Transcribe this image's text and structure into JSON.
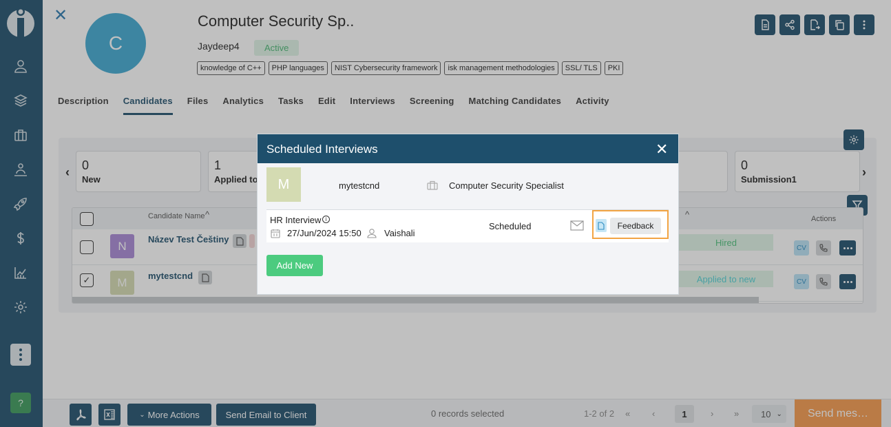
{
  "sidebar": {
    "items": [
      {
        "icon": "person-icon"
      },
      {
        "icon": "layers-icon"
      },
      {
        "icon": "briefcase-icon"
      },
      {
        "icon": "org-chart-icon"
      },
      {
        "icon": "rocket-icon"
      },
      {
        "icon": "dollar-icon"
      },
      {
        "icon": "bar-chart-icon"
      },
      {
        "icon": "gear-icon"
      }
    ],
    "help_label": "?"
  },
  "job": {
    "avatar_letter": "C",
    "title": "Computer Security Sp..",
    "owner": "Jaydeep4",
    "status": "Active",
    "tags": [
      "knowledge of C++",
      "PHP languages",
      "NIST Cybersecurity framework",
      "isk management methodologies",
      "SSL/ TLS",
      "PKI"
    ]
  },
  "tabs": [
    "Description",
    "Candidates",
    "Files",
    "Analytics",
    "Tasks",
    "Edit",
    "Interviews",
    "Screening",
    "Matching Candidates",
    "Activity"
  ],
  "active_tab": "Candidates",
  "stats": [
    {
      "count": "0",
      "label": "New"
    },
    {
      "count": "1",
      "label": "Applied to"
    },
    {
      "count": "0",
      "label": "Submission1"
    }
  ],
  "table": {
    "col_name": "Candidate Name",
    "col_actions": "Actions",
    "rows": [
      {
        "avatar": "N",
        "name": "Název Test Češtiny",
        "stage": "Hired",
        "cv": "CV",
        "checked": false
      },
      {
        "avatar": "M",
        "name": "mytestcnd",
        "stage": "Applied to new",
        "cv": "CV",
        "checked": true
      }
    ]
  },
  "footer": {
    "more_actions": "More Actions",
    "send_email": "Send Email to Client",
    "records_selected": "0 records selected",
    "range": "1-2 of 2",
    "current_page": "1",
    "page_size": "10",
    "send_message": "Send mes…"
  },
  "modal": {
    "title": "Scheduled Interviews",
    "candidate_initial": "M",
    "candidate_name": "mytestcnd",
    "job_title": "Computer Security Specialist",
    "interview": {
      "type": "HR Interview",
      "datetime": "27/Jun/2024 15:50",
      "interviewer": "Vaishali",
      "status": "Scheduled",
      "feedback_label": "Feedback"
    },
    "add_new_label": "Add New"
  },
  "colors": {
    "primary": "#1e4f6c",
    "accent_green": "#4ccb7f",
    "highlight": "#f2a443",
    "send_message": "#f79a4c"
  }
}
